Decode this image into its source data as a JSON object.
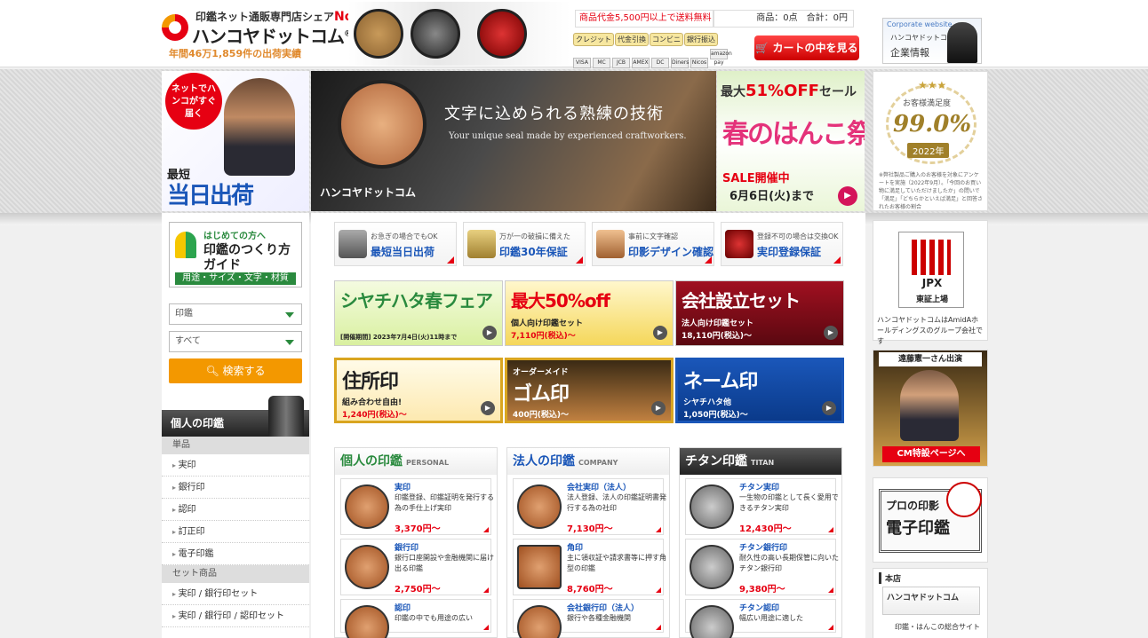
{
  "header": {
    "logo_tagline": "印鑑ネット通販専門店シェア",
    "logo_no1": "No.1",
    "logo_name": "ハンコヤドットコム",
    "logo_registered": "®",
    "shipment_stat": "年間46万1,859件の出荷実績",
    "free_shipping": "商品代金5,500円以上で送料無料",
    "cart_summary": "商品：0点　合計：0円",
    "payment_methods": [
      "クレジット",
      "代金引換",
      "コンビニ",
      "銀行振込"
    ],
    "card_icons": [
      "VISA",
      "MC",
      "JCB",
      "AMEX",
      "DC",
      "Diners",
      "Nicos",
      "amazon pay"
    ],
    "cart_button": "カートの中を見る",
    "corporate": {
      "label": "Corporate website",
      "name": "ハンコヤドットコム",
      "sub": "企業情報"
    }
  },
  "promo_left": {
    "circle": "ネットでハンコがすぐ届く",
    "line1": "最短",
    "line2": "当日出荷"
  },
  "hero": {
    "title": "文字に込められる熟練の技術",
    "subtitle": "Your unique seal made by experienced craftworkers.",
    "brand": "ハンコヤドットコム"
  },
  "sale": {
    "line1_pre": "最大",
    "line1_pct": "51%OFF",
    "line1_post": "セール",
    "title": "春のはんこ祭",
    "status": "SALE開催中",
    "date": "6月6日(火)まで"
  },
  "satisfaction": {
    "stars": "★★★",
    "label": "お客様満足度",
    "value": "99.0%",
    "year": "2022年",
    "note": "※弊社製品ご購入のお客様を対象にアンケートを実施（2022年9月）。「今回のお買い物に満足していただけましたか」の問いで「満足」「どちらかといえば満足」と回答されたお客様の割合"
  },
  "sidebar": {
    "guide": {
      "intro": "はじめての方へ",
      "title1": "印鑑のつくり方",
      "title2": "ガイド",
      "sub": "用途・サイズ・文字・材質"
    },
    "select_category": "印鑑",
    "select_scope": "すべて",
    "search_button": "検索する",
    "section_title": "個人の印鑑",
    "groups": [
      {
        "label": "単品",
        "items": [
          "実印",
          "銀行印",
          "認印",
          "訂正印",
          "電子印鑑"
        ]
      },
      {
        "label": "セット商品",
        "items": [
          "実印 / 銀行印セット",
          "実印 / 銀行印 / 認印セット"
        ]
      }
    ]
  },
  "features": [
    {
      "small": "お急ぎの場合でもOK",
      "big": "最短当日出荷"
    },
    {
      "small": "万が一の破損に備えた",
      "big": "印鑑30年保証"
    },
    {
      "small": "事前に文字確認",
      "big": "印影デザイン確認"
    },
    {
      "small": "登録不可の場合は交換OK",
      "big": "実印登録保証"
    }
  ],
  "banners": [
    {
      "title": "シヤチハタ春フェア",
      "sub": "[開催期間] 2023年7月4日(火)11時まで",
      "price": ""
    },
    {
      "title": "最大50%off",
      "sub": "個人向け印鑑セット",
      "price": "7,110円(税込)〜"
    },
    {
      "title": "会社設立セット",
      "sub": "法人向け印鑑セット",
      "price": "18,110円(税込)〜"
    },
    {
      "title": "住所印",
      "sub": "組み合わせ自由!",
      "price": "1,240円(税込)〜"
    },
    {
      "title": "ゴム印",
      "sub": "オーダーメイド",
      "price": "400円(税込)〜"
    },
    {
      "title": "ネーム印",
      "sub": "シヤチハタ他",
      "price": "1,050円(税込)〜"
    }
  ],
  "columns": [
    {
      "title": "個人の印鑑",
      "en": "PERSONAL",
      "products": [
        {
          "name": "実印",
          "desc": "印鑑登録、印鑑証明を発行する為の手仕上げ実印",
          "price": "3,370円〜"
        },
        {
          "name": "銀行印",
          "desc": "銀行口座開設や金融機関に届け出る印鑑",
          "price": "2,750円〜"
        },
        {
          "name": "認印",
          "desc": "印鑑の中でも用途の広い",
          "price": ""
        }
      ]
    },
    {
      "title": "法人の印鑑",
      "en": "COMPANY",
      "products": [
        {
          "name": "会社実印（法人）",
          "desc": "法人登録、法人の印鑑証明書発行する為の社印",
          "price": "7,130円〜"
        },
        {
          "name": "角印",
          "desc": "主に領収証や請求書等に押す角型の印鑑",
          "price": "8,760円〜"
        },
        {
          "name": "会社銀行印（法人）",
          "desc": "銀行や各種金融機関",
          "price": ""
        }
      ]
    },
    {
      "title": "チタン印鑑",
      "en": "TITAN",
      "products": [
        {
          "name": "チタン実印",
          "desc": "一生物の印鑑として長く愛用できるチタン実印",
          "price": "12,430円〜"
        },
        {
          "name": "チタン銀行印",
          "desc": "耐久性の高い長期保管に向いたチタン銀行印",
          "price": "9,380円〜"
        },
        {
          "name": "チタン認印",
          "desc": "幅広い用途に適した",
          "price": ""
        }
      ]
    }
  ],
  "right": {
    "jpx_logo": "JPX",
    "jpx_sub": "東証上場",
    "jpx_text": "ハンコヤドットコムはAmidAホールディングスのグループ会社です",
    "cm_title": "遠藤憲一さん出演",
    "cm_button": "CM特設ページへ",
    "pro_line1": "プロの印影",
    "pro_line2": "電子印鑑",
    "honten_label": "本店",
    "honten_name": "ハンコヤドットコム",
    "honten_sub": "印鑑・はんこの総合サイト"
  }
}
